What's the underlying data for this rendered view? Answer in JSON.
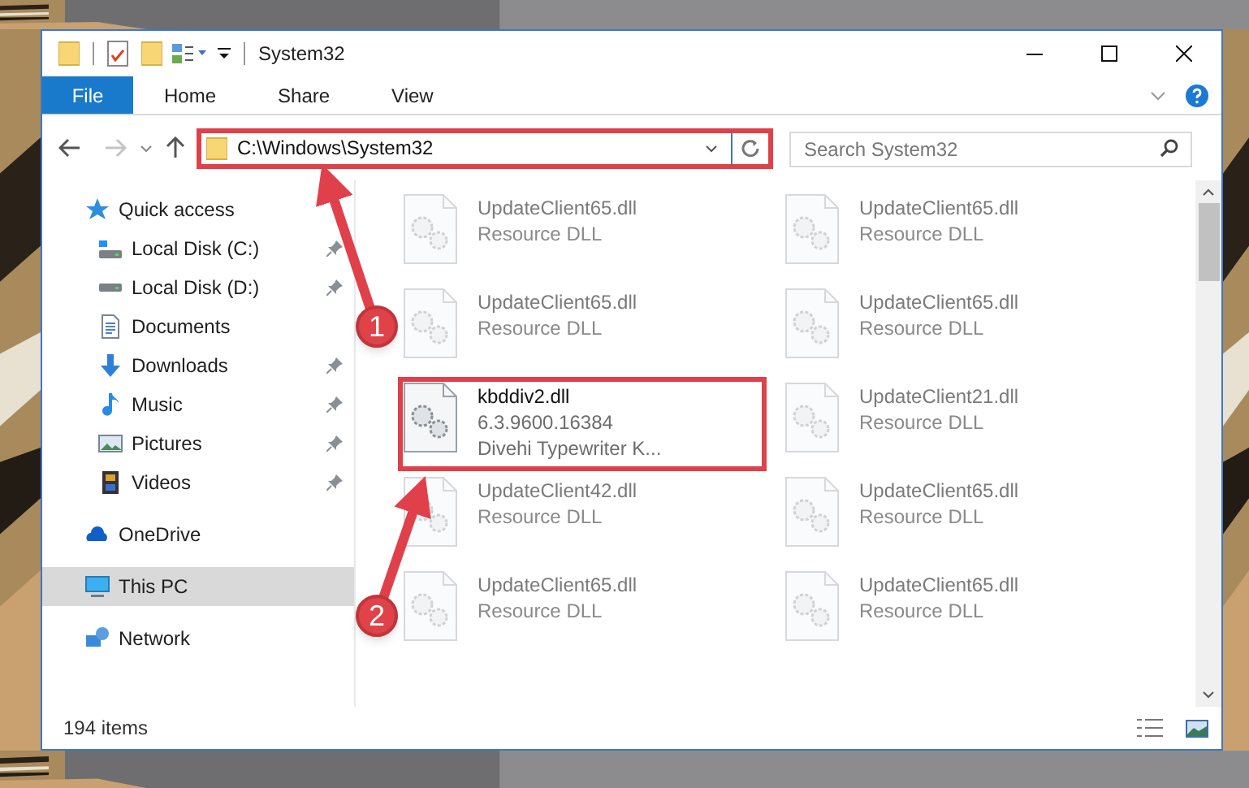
{
  "window": {
    "title": "System32"
  },
  "ribbon": {
    "tabs": [
      {
        "label": "File",
        "selected": true
      },
      {
        "label": "Home",
        "selected": false
      },
      {
        "label": "Share",
        "selected": false
      },
      {
        "label": "View",
        "selected": false
      }
    ]
  },
  "address_bar": {
    "path": "C:\\Windows\\System32",
    "highlighted": true
  },
  "search": {
    "placeholder": "Search System32"
  },
  "sidebar": {
    "items": [
      {
        "label": "Quick access",
        "kind": "star",
        "selected": false,
        "children": [
          {
            "label": "Local Disk (C:)",
            "kind": "system-drive",
            "pinned": true,
            "selected": false
          },
          {
            "label": "Local Disk (D:)",
            "kind": "drive",
            "pinned": true,
            "selected": false
          },
          {
            "label": "Documents",
            "kind": "documents",
            "selected": false
          },
          {
            "label": "Downloads",
            "kind": "downloads",
            "pinned": true,
            "selected": false
          },
          {
            "label": "Music",
            "kind": "music",
            "pinned": true,
            "selected": false
          },
          {
            "label": "Pictures",
            "kind": "pictures",
            "pinned": true,
            "selected": false
          },
          {
            "label": "Videos",
            "kind": "videos",
            "pinned": true,
            "selected": false
          }
        ]
      },
      {
        "label": "OneDrive",
        "kind": "cloud",
        "selected": false
      },
      {
        "label": "This PC",
        "kind": "pc",
        "selected": true
      },
      {
        "label": "Network",
        "kind": "network",
        "selected": false
      }
    ]
  },
  "files": [
    {
      "name": "UpdateClient65.dll",
      "lines": [
        "Resource DLL"
      ],
      "faded": true,
      "highlighted": false
    },
    {
      "name": "UpdateClient65.dll",
      "lines": [
        "Resource DLL"
      ],
      "faded": true,
      "highlighted": false
    },
    {
      "name": "UpdateClient65.dll",
      "lines": [
        "Resource DLL"
      ],
      "faded": true,
      "highlighted": false
    },
    {
      "name": "UpdateClient65.dll",
      "lines": [
        "Resource DLL"
      ],
      "faded": true,
      "highlighted": false
    },
    {
      "name": "kbddiv2.dll",
      "lines": [
        "6.3.9600.16384",
        "Divehi Typewriter K..."
      ],
      "faded": false,
      "highlighted": true
    },
    {
      "name": "UpdateClient21.dll",
      "lines": [
        "Resource DLL"
      ],
      "faded": true,
      "highlighted": false
    },
    {
      "name": "UpdateClient42.dll",
      "lines": [
        "Resource DLL"
      ],
      "faded": true,
      "highlighted": false
    },
    {
      "name": "UpdateClient65.dll",
      "lines": [
        "Resource DLL"
      ],
      "faded": true,
      "highlighted": false
    },
    {
      "name": "UpdateClient65.dll",
      "lines": [
        "Resource DLL"
      ],
      "faded": true,
      "highlighted": false
    },
    {
      "name": "UpdateClient65.dll",
      "lines": [
        "Resource DLL"
      ],
      "faded": true,
      "highlighted": false
    }
  ],
  "status_bar": {
    "count": "194 items"
  },
  "annotations": [
    {
      "label": "1"
    },
    {
      "label": "2"
    }
  ]
}
